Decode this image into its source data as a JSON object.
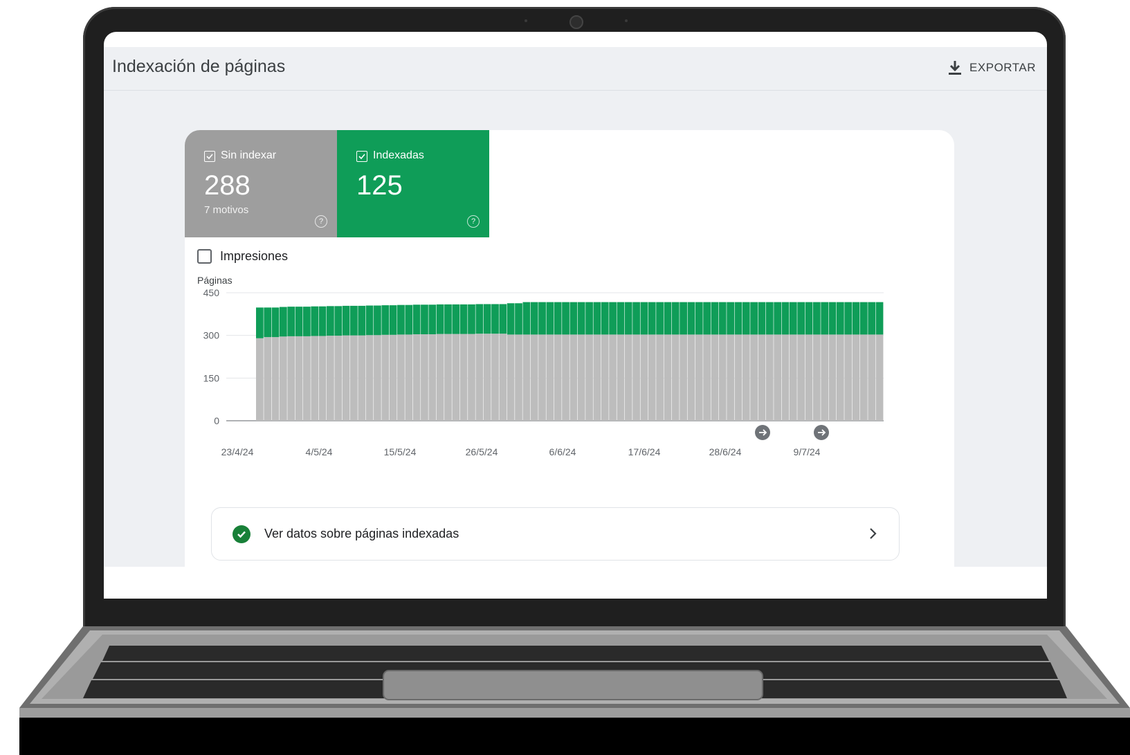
{
  "header": {
    "title": "Indexación de páginas",
    "export_label": "EXPORTAR"
  },
  "tiles": [
    {
      "label": "Sin indexar",
      "value": "288",
      "sub": "7 motivos",
      "color": "#9e9e9e"
    },
    {
      "label": "Indexadas",
      "value": "125",
      "sub": "",
      "color": "#0f9d58"
    }
  ],
  "impressions_label": "Impresiones",
  "chart_data": {
    "type": "bar",
    "stacked": true,
    "ylabel": "Páginas",
    "ylim": [
      0,
      450
    ],
    "yticks": [
      "450",
      "300",
      "150",
      "0"
    ],
    "xtick_labels": [
      "23/4/24",
      "4/5/24",
      "15/5/24",
      "26/5/24",
      "6/6/24",
      "17/6/24",
      "28/6/24",
      "9/7/24"
    ],
    "grid": true,
    "annotations": 2,
    "series": [
      {
        "color": "#bdbdbd",
        "values": [
          290,
          294,
          294,
          296,
          297,
          297,
          297,
          298,
          298,
          299,
          299,
          300,
          300,
          300,
          301,
          301,
          302,
          302,
          303,
          303,
          304,
          304,
          304,
          305,
          305,
          305,
          305,
          305,
          306,
          306,
          306,
          306,
          303,
          303,
          303,
          303,
          303,
          303,
          303,
          303,
          303,
          303,
          303,
          303,
          303,
          303,
          303,
          303,
          303,
          303,
          303,
          303,
          303,
          303,
          303,
          303,
          303,
          303,
          303,
          303,
          303,
          303,
          303,
          303,
          303,
          303,
          303,
          303,
          303,
          303,
          303,
          303,
          303,
          303,
          303,
          303,
          303,
          303,
          303,
          303
        ]
      },
      {
        "color": "#0f9d58",
        "values": [
          108,
          104,
          104,
          104,
          104,
          104,
          104,
          104,
          104,
          104,
          104,
          104,
          104,
          104,
          104,
          104,
          104,
          104,
          104,
          104,
          104,
          104,
          104,
          104,
          104,
          104,
          104,
          104,
          104,
          104,
          104,
          104,
          110,
          110,
          114,
          114,
          114,
          114,
          114,
          114,
          114,
          114,
          114,
          114,
          114,
          114,
          114,
          114,
          114,
          114,
          114,
          114,
          114,
          114,
          114,
          114,
          114,
          114,
          114,
          114,
          114,
          114,
          114,
          114,
          114,
          114,
          114,
          114,
          114,
          114,
          114,
          114,
          114,
          114,
          114,
          114,
          114,
          114,
          114,
          114
        ]
      }
    ]
  },
  "link": {
    "label": "Ver datos sobre páginas indexadas"
  },
  "colors": {
    "accent_green": "#0f9d58",
    "gray_series": "#bdbdbd",
    "app_bg": "#eef0f3"
  }
}
